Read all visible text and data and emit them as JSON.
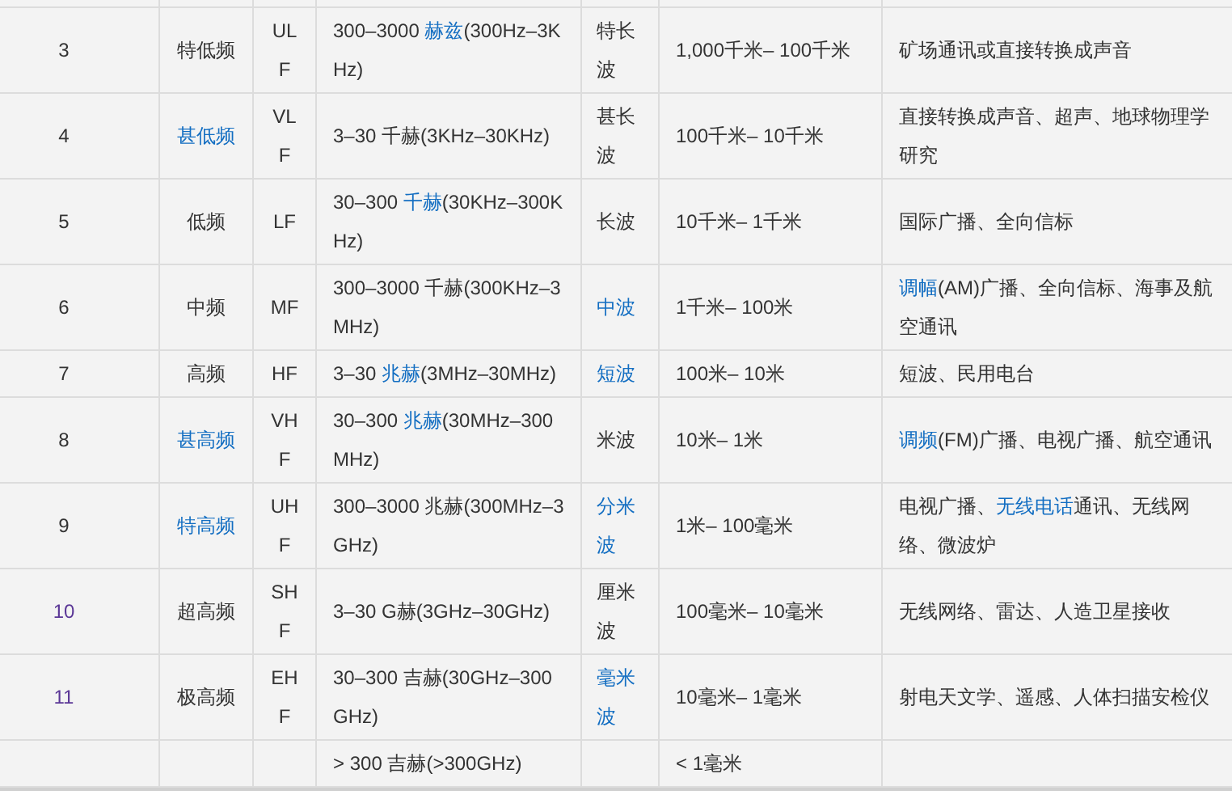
{
  "table": {
    "rows": [
      {
        "cells": [
          [
            {
              "text": "3",
              "kind": "plain"
            }
          ],
          [
            {
              "text": "特低频",
              "kind": "plain"
            }
          ],
          [
            {
              "text": "ULF",
              "kind": "plain"
            }
          ],
          [
            {
              "text": "300–3000 ",
              "kind": "plain"
            },
            {
              "text": "赫兹",
              "kind": "link"
            },
            {
              "text": "(300Hz–3KHz)",
              "kind": "plain"
            }
          ],
          [
            {
              "text": "特长波",
              "kind": "plain"
            }
          ],
          [
            {
              "text": "1,000千米– 100千米",
              "kind": "plain"
            }
          ],
          [
            {
              "text": "矿场通讯或直接转换成声音",
              "kind": "plain"
            }
          ]
        ]
      },
      {
        "cells": [
          [
            {
              "text": "4",
              "kind": "plain"
            }
          ],
          [
            {
              "text": "甚低频",
              "kind": "link"
            }
          ],
          [
            {
              "text": "VLF",
              "kind": "plain"
            }
          ],
          [
            {
              "text": "3–30 千赫(3KHz–30KHz)",
              "kind": "plain"
            }
          ],
          [
            {
              "text": "甚长波",
              "kind": "plain"
            }
          ],
          [
            {
              "text": "100千米– 10千米",
              "kind": "plain"
            }
          ],
          [
            {
              "text": "直接转换成声音、超声、地球物理学研究",
              "kind": "plain"
            }
          ]
        ]
      },
      {
        "cells": [
          [
            {
              "text": "5",
              "kind": "plain"
            }
          ],
          [
            {
              "text": "低频",
              "kind": "plain"
            }
          ],
          [
            {
              "text": "LF",
              "kind": "plain"
            }
          ],
          [
            {
              "text": "30–300 ",
              "kind": "plain"
            },
            {
              "text": "千赫",
              "kind": "link"
            },
            {
              "text": "(30KHz–300KHz)",
              "kind": "plain"
            }
          ],
          [
            {
              "text": "长波",
              "kind": "plain"
            }
          ],
          [
            {
              "text": "10千米– 1千米",
              "kind": "plain"
            }
          ],
          [
            {
              "text": "国际广播、全向信标",
              "kind": "plain"
            }
          ]
        ]
      },
      {
        "cells": [
          [
            {
              "text": "6",
              "kind": "plain"
            }
          ],
          [
            {
              "text": "中频",
              "kind": "plain"
            }
          ],
          [
            {
              "text": "MF",
              "kind": "plain"
            }
          ],
          [
            {
              "text": "300–3000 千赫(300KHz–3MHz)",
              "kind": "plain"
            }
          ],
          [
            {
              "text": "中波",
              "kind": "link"
            }
          ],
          [
            {
              "text": "1千米– 100米",
              "kind": "plain"
            }
          ],
          [
            {
              "text": "调幅",
              "kind": "link"
            },
            {
              "text": "(AM)广播、全向信标、海事及航空通讯",
              "kind": "plain"
            }
          ]
        ]
      },
      {
        "cells": [
          [
            {
              "text": "7",
              "kind": "plain"
            }
          ],
          [
            {
              "text": "高频",
              "kind": "plain"
            }
          ],
          [
            {
              "text": "HF",
              "kind": "plain"
            }
          ],
          [
            {
              "text": "3–30 ",
              "kind": "plain"
            },
            {
              "text": "兆赫",
              "kind": "link"
            },
            {
              "text": "(3MHz–30MHz)",
              "kind": "plain"
            }
          ],
          [
            {
              "text": "短波",
              "kind": "link"
            }
          ],
          [
            {
              "text": "100米– 10米",
              "kind": "plain"
            }
          ],
          [
            {
              "text": "短波、民用电台",
              "kind": "plain"
            }
          ]
        ]
      },
      {
        "cells": [
          [
            {
              "text": "8",
              "kind": "plain"
            }
          ],
          [
            {
              "text": "甚高频",
              "kind": "link"
            }
          ],
          [
            {
              "text": "VHF",
              "kind": "plain"
            }
          ],
          [
            {
              "text": "30–300 ",
              "kind": "plain"
            },
            {
              "text": "兆赫",
              "kind": "link"
            },
            {
              "text": "(30MHz–300MHz)",
              "kind": "plain"
            }
          ],
          [
            {
              "text": "米波",
              "kind": "plain"
            }
          ],
          [
            {
              "text": "10米– 1米",
              "kind": "plain"
            }
          ],
          [
            {
              "text": "调频",
              "kind": "link"
            },
            {
              "text": "(FM)广播、电视广播、航空通讯",
              "kind": "plain"
            }
          ]
        ]
      },
      {
        "cells": [
          [
            {
              "text": "9",
              "kind": "plain"
            }
          ],
          [
            {
              "text": "特高频",
              "kind": "link"
            }
          ],
          [
            {
              "text": "UHF",
              "kind": "plain"
            }
          ],
          [
            {
              "text": "300–3000 兆赫(300MHz–3GHz)",
              "kind": "plain"
            }
          ],
          [
            {
              "text": "分米波",
              "kind": "link"
            }
          ],
          [
            {
              "text": "1米– 100毫米",
              "kind": "plain"
            }
          ],
          [
            {
              "text": "电视广播、",
              "kind": "plain"
            },
            {
              "text": "无线电话",
              "kind": "link"
            },
            {
              "text": "通讯、无线网络、微波炉",
              "kind": "plain"
            }
          ]
        ]
      },
      {
        "cells": [
          [
            {
              "text": "10",
              "kind": "visited"
            }
          ],
          [
            {
              "text": "超高频",
              "kind": "plain"
            }
          ],
          [
            {
              "text": "SHF",
              "kind": "plain"
            }
          ],
          [
            {
              "text": "3–30 G赫(3GHz–30GHz)",
              "kind": "plain"
            }
          ],
          [
            {
              "text": "厘米波",
              "kind": "plain"
            }
          ],
          [
            {
              "text": "100毫米– 10毫米",
              "kind": "plain"
            }
          ],
          [
            {
              "text": "无线网络、雷达、人造卫星接收",
              "kind": "plain"
            }
          ]
        ]
      },
      {
        "cells": [
          [
            {
              "text": "11",
              "kind": "visited"
            }
          ],
          [
            {
              "text": "极高频",
              "kind": "plain"
            }
          ],
          [
            {
              "text": "EHF",
              "kind": "plain"
            }
          ],
          [
            {
              "text": "30–300 吉赫(30GHz–300GHz)",
              "kind": "plain"
            }
          ],
          [
            {
              "text": "毫米波",
              "kind": "link"
            }
          ],
          [
            {
              "text": "10毫米– 1毫米",
              "kind": "plain"
            }
          ],
          [
            {
              "text": "射电天文学、遥感、人体扫描安检仪",
              "kind": "plain"
            }
          ]
        ]
      },
      {
        "cells": [
          null,
          null,
          null,
          [
            {
              "text": "> 300 吉赫(>300GHz)",
              "kind": "plain"
            }
          ],
          null,
          [
            {
              "text": "< 1毫米",
              "kind": "plain"
            }
          ],
          null
        ]
      }
    ]
  }
}
